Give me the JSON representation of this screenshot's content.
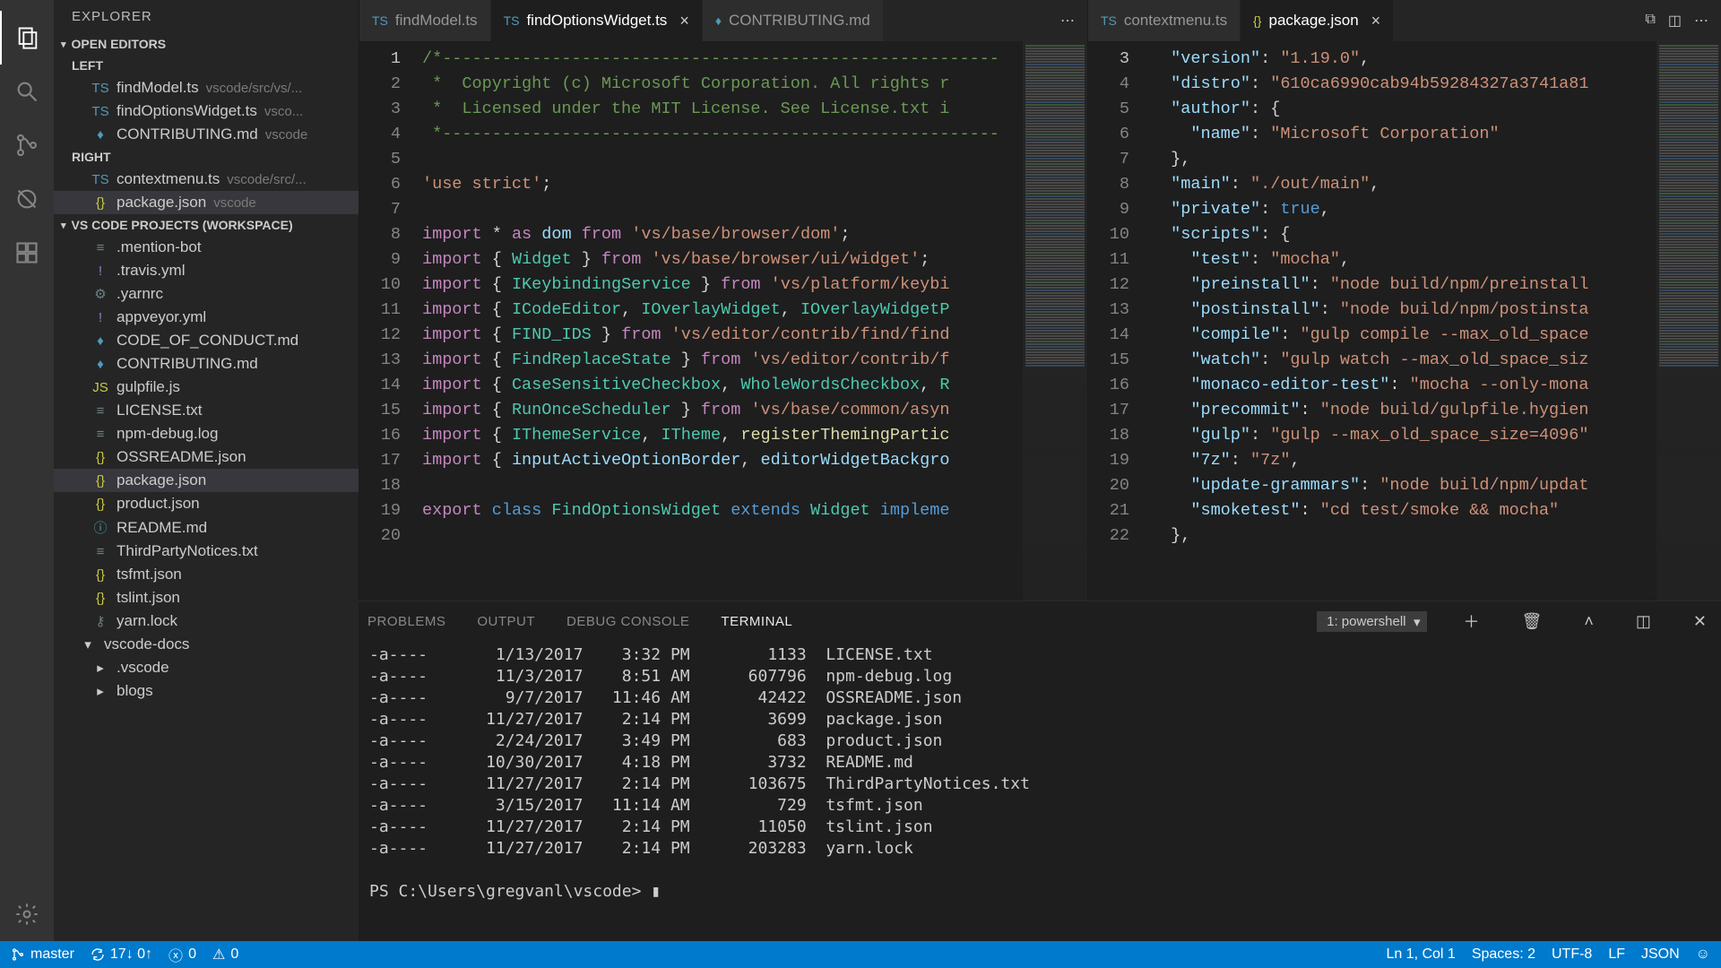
{
  "sidebar": {
    "title": "EXPLORER",
    "sections": {
      "openEditors": "OPEN EDITORS",
      "workspace": "VS CODE PROJECTS (WORKSPACE)"
    },
    "groups": {
      "left": "LEFT",
      "right": "RIGHT"
    },
    "openLeft": [
      {
        "name": "findModel.ts",
        "meta": "vscode/src/vs/...",
        "icon": "TS",
        "cls": "icon-ts"
      },
      {
        "name": "findOptionsWidget.ts",
        "meta": "vsco...",
        "icon": "TS",
        "cls": "icon-ts"
      },
      {
        "name": "CONTRIBUTING.md",
        "meta": "vscode",
        "icon": "♦",
        "cls": "icon-md"
      }
    ],
    "openRight": [
      {
        "name": "contextmenu.ts",
        "meta": "vscode/src/...",
        "icon": "TS",
        "cls": "icon-ts"
      },
      {
        "name": "package.json",
        "meta": "vscode",
        "icon": "{}",
        "cls": "icon-json",
        "selected": true
      }
    ],
    "tree": [
      {
        "name": ".mention-bot",
        "icon": "≡",
        "cls": "icon-generic"
      },
      {
        "name": ".travis.yml",
        "icon": "!",
        "cls": "icon-yml"
      },
      {
        "name": ".yarnrc",
        "icon": "⚙",
        "cls": "icon-generic"
      },
      {
        "name": "appveyor.yml",
        "icon": "!",
        "cls": "icon-yml"
      },
      {
        "name": "CODE_OF_CONDUCT.md",
        "icon": "♦",
        "cls": "icon-md"
      },
      {
        "name": "CONTRIBUTING.md",
        "icon": "♦",
        "cls": "icon-md"
      },
      {
        "name": "gulpfile.js",
        "icon": "JS",
        "cls": "icon-js"
      },
      {
        "name": "LICENSE.txt",
        "icon": "≡",
        "cls": "icon-txt"
      },
      {
        "name": "npm-debug.log",
        "icon": "≡",
        "cls": "icon-log"
      },
      {
        "name": "OSSREADME.json",
        "icon": "{}",
        "cls": "icon-json"
      },
      {
        "name": "package.json",
        "icon": "{}",
        "cls": "icon-json",
        "selected": true
      },
      {
        "name": "product.json",
        "icon": "{}",
        "cls": "icon-json"
      },
      {
        "name": "README.md",
        "icon": "ⓘ",
        "cls": "icon-info"
      },
      {
        "name": "ThirdPartyNotices.txt",
        "icon": "≡",
        "cls": "icon-txt"
      },
      {
        "name": "tsfmt.json",
        "icon": "{}",
        "cls": "icon-json"
      },
      {
        "name": "tslint.json",
        "icon": "{}",
        "cls": "icon-json"
      },
      {
        "name": "yarn.lock",
        "icon": "⚷",
        "cls": "icon-lock"
      }
    ],
    "folders": [
      {
        "name": "vscode-docs",
        "expanded": true
      },
      {
        "name": ".vscode",
        "expanded": false,
        "indent": true
      },
      {
        "name": "blogs",
        "expanded": false,
        "indent": true
      }
    ]
  },
  "tabs": {
    "left": [
      {
        "label": "findModel.ts",
        "icon": "TS",
        "cls": "icon-ts"
      },
      {
        "label": "findOptionsWidget.ts",
        "icon": "TS",
        "cls": "icon-ts",
        "active": true,
        "close": true
      },
      {
        "label": "CONTRIBUTING.md",
        "icon": "♦",
        "cls": "icon-md"
      }
    ],
    "right": [
      {
        "label": "contextmenu.ts",
        "icon": "TS",
        "cls": "icon-ts"
      },
      {
        "label": "package.json",
        "icon": "{}",
        "cls": "icon-json",
        "active": true,
        "close": true
      }
    ],
    "overflow": "⋯"
  },
  "editorLeft": {
    "startLine": 1,
    "lines": [
      "<span class='tok-comment'>/*--------------------------------------------------------</span>",
      "<span class='tok-comment'> *  Copyright (c) Microsoft Corporation. All rights r</span>",
      "<span class='tok-comment'> *  Licensed under the MIT License. See License.txt i</span>",
      "<span class='tok-comment'> *--------------------------------------------------------</span>",
      "",
      "<span class='tok-str'>'use strict'</span><span class='tok-punc'>;</span>",
      "",
      "<span class='tok-keyctl'>import</span> <span class='tok-punc'>*</span> <span class='tok-keyctl'>as</span> <span class='tok-prop'>dom</span> <span class='tok-keyctl'>from</span> <span class='tok-str'>'vs/base/browser/dom'</span><span class='tok-punc'>;</span>",
      "<span class='tok-keyctl'>import</span> <span class='tok-punc'>{</span> <span class='tok-type'>Widget</span> <span class='tok-punc'>}</span> <span class='tok-keyctl'>from</span> <span class='tok-str'>'vs/base/browser/ui/widget'</span><span class='tok-punc'>;</span>",
      "<span class='tok-keyctl'>import</span> <span class='tok-punc'>{</span> <span class='tok-type'>IKeybindingService</span> <span class='tok-punc'>}</span> <span class='tok-keyctl'>from</span> <span class='tok-str'>'vs/platform/keybi</span>",
      "<span class='tok-keyctl'>import</span> <span class='tok-punc'>{</span> <span class='tok-type'>ICodeEditor</span><span class='tok-punc'>,</span> <span class='tok-type'>IOverlayWidget</span><span class='tok-punc'>,</span> <span class='tok-type'>IOverlayWidgetP</span>",
      "<span class='tok-keyctl'>import</span> <span class='tok-punc'>{</span> <span class='tok-type'>FIND_IDS</span> <span class='tok-punc'>}</span> <span class='tok-keyctl'>from</span> <span class='tok-str'>'vs/editor/contrib/find/find</span>",
      "<span class='tok-keyctl'>import</span> <span class='tok-punc'>{</span> <span class='tok-type'>FindReplaceState</span> <span class='tok-punc'>}</span> <span class='tok-keyctl'>from</span> <span class='tok-str'>'vs/editor/contrib/f</span>",
      "<span class='tok-keyctl'>import</span> <span class='tok-punc'>{</span> <span class='tok-type'>CaseSensitiveCheckbox</span><span class='tok-punc'>,</span> <span class='tok-type'>WholeWordsCheckbox</span><span class='tok-punc'>,</span> <span class='tok-type'>R</span>",
      "<span class='tok-keyctl'>import</span> <span class='tok-punc'>{</span> <span class='tok-type'>RunOnceScheduler</span> <span class='tok-punc'>}</span> <span class='tok-keyctl'>from</span> <span class='tok-str'>'vs/base/common/asyn</span>",
      "<span class='tok-keyctl'>import</span> <span class='tok-punc'>{</span> <span class='tok-type'>IThemeService</span><span class='tok-punc'>,</span> <span class='tok-type'>ITheme</span><span class='tok-punc'>,</span> <span class='tok-fn'>registerThemingPartic</span>",
      "<span class='tok-keyctl'>import</span> <span class='tok-punc'>{</span> <span class='tok-prop'>inputActiveOptionBorder</span><span class='tok-punc'>,</span> <span class='tok-prop'>editorWidgetBackgro</span>",
      "",
      "<span class='tok-keyctl'>export</span> <span class='tok-key'>class</span> <span class='tok-type'>FindOptionsWidget</span> <span class='tok-key'>extends</span> <span class='tok-type'>Widget</span> <span class='tok-key'>impleme</span>",
      ""
    ]
  },
  "editorRight": {
    "startLine": 3,
    "lines": [
      "  <span class='tok-prop'>\"version\"</span><span class='tok-punc'>:</span> <span class='tok-str'>\"1.19.0\"</span><span class='tok-punc'>,</span>",
      "  <span class='tok-prop'>\"distro\"</span><span class='tok-punc'>:</span> <span class='tok-str'>\"610ca6990cab94b59284327a3741a81</span>",
      "  <span class='tok-prop'>\"author\"</span><span class='tok-punc'>: {</span>",
      "    <span class='tok-prop'>\"name\"</span><span class='tok-punc'>:</span> <span class='tok-str'>\"Microsoft Corporation\"</span>",
      "  <span class='tok-punc'>},</span>",
      "  <span class='tok-prop'>\"main\"</span><span class='tok-punc'>:</span> <span class='tok-str'>\"./out/main\"</span><span class='tok-punc'>,</span>",
      "  <span class='tok-prop'>\"private\"</span><span class='tok-punc'>:</span> <span class='tok-const'>true</span><span class='tok-punc'>,</span>",
      "  <span class='tok-prop'>\"scripts\"</span><span class='tok-punc'>: {</span>",
      "    <span class='tok-prop'>\"test\"</span><span class='tok-punc'>:</span> <span class='tok-str'>\"mocha\"</span><span class='tok-punc'>,</span>",
      "    <span class='tok-prop'>\"preinstall\"</span><span class='tok-punc'>:</span> <span class='tok-str'>\"node build/npm/preinstall</span>",
      "    <span class='tok-prop'>\"postinstall\"</span><span class='tok-punc'>:</span> <span class='tok-str'>\"node build/npm/postinsta</span>",
      "    <span class='tok-prop'>\"compile\"</span><span class='tok-punc'>:</span> <span class='tok-str'>\"gulp compile --max_old_space</span>",
      "    <span class='tok-prop'>\"watch\"</span><span class='tok-punc'>:</span> <span class='tok-str'>\"gulp watch --max_old_space_siz</span>",
      "    <span class='tok-prop'>\"monaco-editor-test\"</span><span class='tok-punc'>:</span> <span class='tok-str'>\"mocha --only-mona</span>",
      "    <span class='tok-prop'>\"precommit\"</span><span class='tok-punc'>:</span> <span class='tok-str'>\"node build/gulpfile.hygien</span>",
      "    <span class='tok-prop'>\"gulp\"</span><span class='tok-punc'>:</span> <span class='tok-str'>\"gulp --max_old_space_size=4096\"</span>",
      "    <span class='tok-prop'>\"7z\"</span><span class='tok-punc'>:</span> <span class='tok-str'>\"7z\"</span><span class='tok-punc'>,</span>",
      "    <span class='tok-prop'>\"update-grammars\"</span><span class='tok-punc'>:</span> <span class='tok-str'>\"node build/npm/updat</span>",
      "    <span class='tok-prop'>\"smoketest\"</span><span class='tok-punc'>:</span> <span class='tok-str'>\"cd test/smoke && mocha\"</span>",
      "  <span class='tok-punc'>},</span>"
    ]
  },
  "panel": {
    "tabs": [
      "PROBLEMS",
      "OUTPUT",
      "DEBUG CONSOLE",
      "TERMINAL"
    ],
    "activeTab": "TERMINAL",
    "terminalSelector": "1: powershell",
    "rows": [
      {
        "mode": "-a----",
        "date": "1/13/2017",
        "time": "3:32 PM",
        "size": "1133",
        "name": "LICENSE.txt"
      },
      {
        "mode": "-a----",
        "date": "11/3/2017",
        "time": "8:51 AM",
        "size": "607796",
        "name": "npm-debug.log"
      },
      {
        "mode": "-a----",
        "date": "9/7/2017",
        "time": "11:46 AM",
        "size": "42422",
        "name": "OSSREADME.json"
      },
      {
        "mode": "-a----",
        "date": "11/27/2017",
        "time": "2:14 PM",
        "size": "3699",
        "name": "package.json"
      },
      {
        "mode": "-a----",
        "date": "2/24/2017",
        "time": "3:49 PM",
        "size": "683",
        "name": "product.json"
      },
      {
        "mode": "-a----",
        "date": "10/30/2017",
        "time": "4:18 PM",
        "size": "3732",
        "name": "README.md"
      },
      {
        "mode": "-a----",
        "date": "11/27/2017",
        "time": "2:14 PM",
        "size": "103675",
        "name": "ThirdPartyNotices.txt"
      },
      {
        "mode": "-a----",
        "date": "3/15/2017",
        "time": "11:14 AM",
        "size": "729",
        "name": "tsfmt.json"
      },
      {
        "mode": "-a----",
        "date": "11/27/2017",
        "time": "2:14 PM",
        "size": "11050",
        "name": "tslint.json"
      },
      {
        "mode": "-a----",
        "date": "11/27/2017",
        "time": "2:14 PM",
        "size": "203283",
        "name": "yarn.lock"
      }
    ],
    "prompt": "PS C:\\Users\\gregvanl\\vscode> "
  },
  "status": {
    "branch": "master",
    "sync": "17↓ 0↑",
    "errors": "0",
    "warnings": "0",
    "lncol": "Ln 1, Col 1",
    "spaces": "Spaces: 2",
    "encoding": "UTF-8",
    "eol": "LF",
    "lang": "JSON"
  }
}
